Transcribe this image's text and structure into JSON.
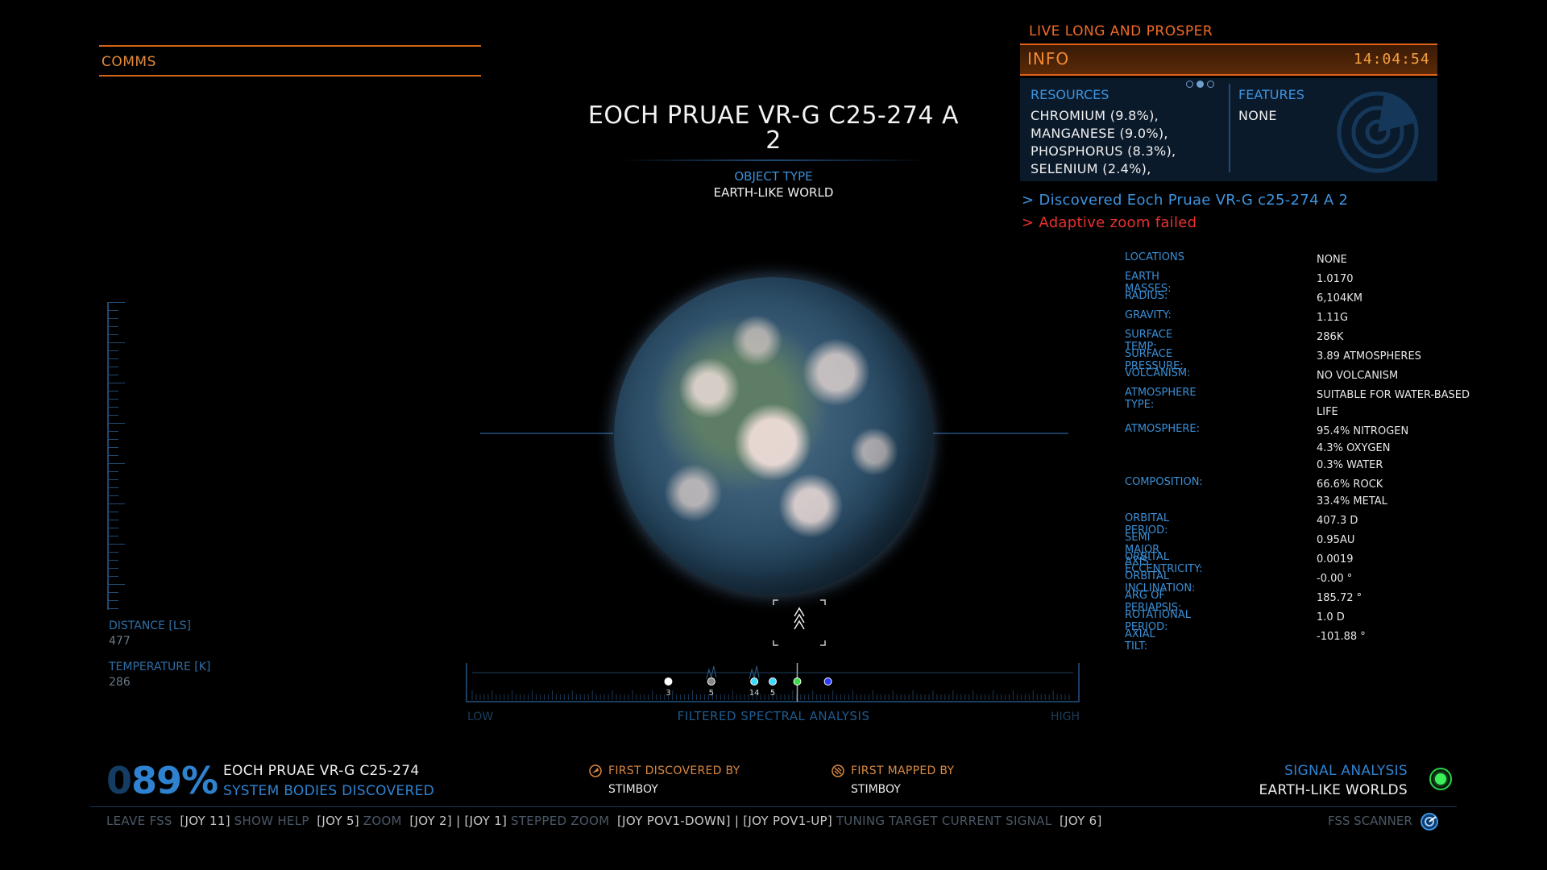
{
  "comms": {
    "label": "COMMS"
  },
  "body": {
    "title": "EOCH PRUAE VR-G C25-274 A 2",
    "object_type_label": "OBJECT TYPE",
    "object_type": "EARTH-LIKE WORLD"
  },
  "left_stats": {
    "distance_label": "DISTANCE [LS]",
    "distance_value": "477",
    "temperature_label": "TEMPERATURE [K]",
    "temperature_value": "286"
  },
  "info": {
    "live_text": "LIVE LONG AND PROSPER",
    "label": "INFO",
    "time": "14:04:54",
    "resources_label": "RESOURCES",
    "resources": [
      "CHROMIUM (9.8%),",
      "MANGANESE (9.0%),",
      "PHOSPHORUS (8.3%),",
      "SELENIUM (2.4%),"
    ],
    "features_label": "FEATURES",
    "features_value": "NONE",
    "message_discovered": "> Discovered Eoch Pruae VR-G c25-274 A 2",
    "message_zoom": "> Adaptive zoom failed",
    "page_dots": 3,
    "active_dot": 2
  },
  "details": [
    {
      "label": "LOCATIONS",
      "value": [
        "NONE"
      ]
    },
    {
      "label": "EARTH MASSES:",
      "value": [
        "1.0170"
      ]
    },
    {
      "label": "RADIUS:",
      "value": [
        "6,104KM"
      ]
    },
    {
      "label": "GRAVITY:",
      "value": [
        "1.11G"
      ]
    },
    {
      "label": "SURFACE TEMP:",
      "value": [
        "286K"
      ]
    },
    {
      "label": "SURFACE PRESSURE:",
      "value": [
        "3.89 ATMOSPHERES"
      ]
    },
    {
      "label": "VOLCANISM:",
      "value": [
        "NO VOLCANISM"
      ]
    },
    {
      "label": "ATMOSPHERE TYPE:",
      "value": [
        "SUITABLE FOR WATER-BASED",
        "LIFE"
      ]
    },
    {
      "label": "ATMOSPHERE:",
      "value": [
        "95.4% NITROGEN",
        "4.3% OXYGEN",
        "0.3% WATER"
      ]
    },
    {
      "label": "COMPOSITION:",
      "value": [
        "66.6% ROCK",
        "33.4% METAL"
      ]
    },
    {
      "label": "ORBITAL PERIOD:",
      "value": [
        "407.3 D"
      ]
    },
    {
      "label": "SEMI MAJOR AXIS:",
      "value": [
        "0.95AU"
      ]
    },
    {
      "label": "ORBITAL ECCENTRICITY:",
      "value": [
        "0.0019"
      ]
    },
    {
      "label": "ORBITAL INCLINATION:",
      "value": [
        "-0.00 °"
      ]
    },
    {
      "label": "ARG OF PERIAPSIS:",
      "value": [
        "185.72 °"
      ]
    },
    {
      "label": "ROTATIONAL PERIOD:",
      "value": [
        "1.0 D"
      ]
    },
    {
      "label": "AXIAL TILT:",
      "value": [
        "-101.88 °"
      ]
    }
  ],
  "spectrum": {
    "low_label": "LOW",
    "high_label": "HIGH",
    "title": "FILTERED SPECTRAL ANALYSIS",
    "markers": [
      {
        "pos": 0.33,
        "color": "#ffffff",
        "count": "3"
      },
      {
        "pos": 0.4,
        "color": "#888888",
        "count": "5"
      },
      {
        "pos": 0.47,
        "color": "#3fd8ff",
        "count": "14"
      },
      {
        "pos": 0.5,
        "color": "#3fd8ff",
        "count": "5"
      },
      {
        "pos": 0.54,
        "color": "#3cdb4a",
        "count": ""
      },
      {
        "pos": 0.59,
        "color": "#2a3cff",
        "count": ""
      }
    ],
    "tuner_pos": 0.54,
    "colors": {
      "frame": "#1c3e60",
      "tick": "#1a3856"
    }
  },
  "footer": {
    "percent_prefix": "0",
    "percent": "89%",
    "system_name": "EOCH PRUAE VR-G C25-274",
    "bodies_label": "SYSTEM BODIES DISCOVERED",
    "first_discovered_label": "FIRST DISCOVERED BY",
    "first_discovered_value": "STIMBOY",
    "first_mapped_label": "FIRST MAPPED BY",
    "first_mapped_value": "STIMBOY",
    "signal_label": "SIGNAL ANALYSIS",
    "signal_value": "EARTH-LIKE WORLDS",
    "signal_color": "#3cf05a"
  },
  "controls": [
    {
      "label": "LEAVE FSS",
      "key": "[JOY 11]"
    },
    {
      "label": "SHOW HELP",
      "key": "[JOY 5]"
    },
    {
      "label": "ZOOM",
      "key": "[JOY 2] |  [JOY 1]"
    },
    {
      "label": "STEPPED ZOOM",
      "key": "[JOY POV1-DOWN] |  [JOY POV1-UP]"
    },
    {
      "label": "TUNING",
      "key": ""
    },
    {
      "label": "TARGET CURRENT SIGNAL",
      "key": "[JOY 6]"
    }
  ],
  "fss": {
    "label": "FSS SCANNER",
    "icon": "fss-scanner-icon"
  }
}
